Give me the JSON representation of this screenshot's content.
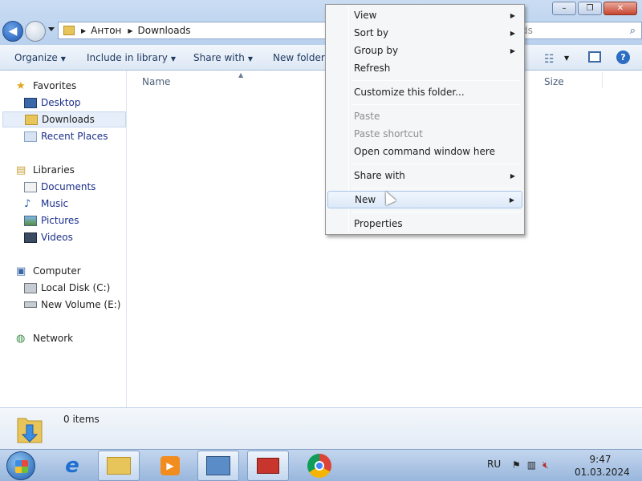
{
  "window": {
    "buttons": {
      "minimize": "–",
      "restore": "❐",
      "close": "✕"
    }
  },
  "address": {
    "crumbs": [
      "Антон",
      "Downloads"
    ],
    "search_fragment": "ds"
  },
  "toolbar": {
    "organize": "Organize",
    "include_in_library": "Include in library",
    "share_with": "Share with",
    "new_folder": "New folder"
  },
  "sidebar": {
    "favorites": {
      "label": "Favorites",
      "items": [
        {
          "label": "Desktop"
        },
        {
          "label": "Downloads",
          "selected": true
        },
        {
          "label": "Recent Places"
        }
      ]
    },
    "libraries": {
      "label": "Libraries",
      "items": [
        {
          "label": "Documents"
        },
        {
          "label": "Music"
        },
        {
          "label": "Pictures"
        },
        {
          "label": "Videos"
        }
      ]
    },
    "computer": {
      "label": "Computer",
      "items": [
        {
          "label": "Local Disk (C:)"
        },
        {
          "label": "New Volume (E:)"
        }
      ]
    },
    "network": {
      "label": "Network"
    }
  },
  "filelist": {
    "columns": {
      "name": "Name",
      "size": "Size"
    }
  },
  "details": {
    "items_count": "0 items"
  },
  "context_menu": {
    "items": [
      {
        "label": "View",
        "submenu": true
      },
      {
        "label": "Sort by",
        "submenu": true
      },
      {
        "label": "Group by",
        "submenu": true
      },
      {
        "label": "Refresh"
      },
      {
        "label": "Customize this folder..."
      },
      {
        "label": "Paste",
        "disabled": true
      },
      {
        "label": "Paste shortcut",
        "disabled": true
      },
      {
        "label": "Open command window here"
      },
      {
        "label": "Share with",
        "submenu": true
      },
      {
        "label": "New",
        "submenu": true,
        "hover": true
      },
      {
        "label": "Properties"
      }
    ]
  },
  "taskbar": {
    "lang": "RU",
    "time": "9:47",
    "date": "01.03.2024"
  },
  "colors": {
    "accent": "#2b6dc3",
    "link": "#1a2e8a",
    "menu_hover": "#dde9f8"
  }
}
